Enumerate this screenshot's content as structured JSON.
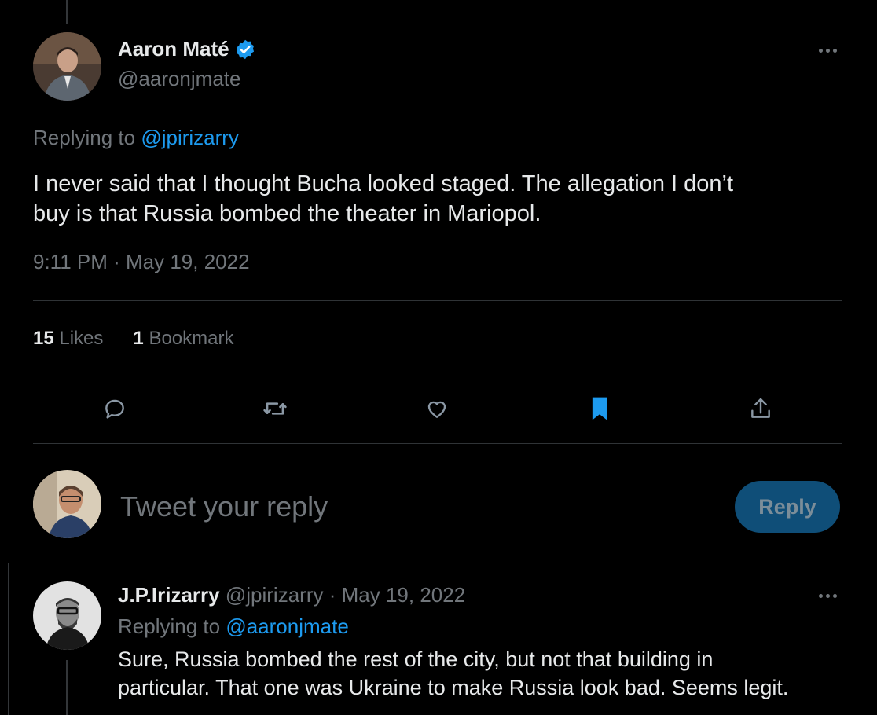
{
  "main_tweet": {
    "author_name": "Aaron Maté",
    "author_handle": "@aaronjmate",
    "replying_prefix": "Replying to",
    "replying_to": "@jpirizarry",
    "text_line1": "I never said that I thought Bucha looked staged. The allegation I don’t",
    "text_line2": "buy is that Russia bombed the theater in Mariopol.",
    "timestamp": "9:11 PM · May 19, 2022",
    "likes_count": "15",
    "likes_label": "Likes",
    "bookmarks_count": "1",
    "bookmarks_label": "Bookmark"
  },
  "actions": {
    "icons": [
      "reply-icon",
      "retweet-icon",
      "like-icon",
      "bookmark-icon",
      "share-icon"
    ],
    "bookmark_active_color": "#1d9bf0"
  },
  "composer": {
    "placeholder": "Tweet your reply",
    "button_label": "Reply"
  },
  "reply_tweet": {
    "author_name": "J.P.Irizarry",
    "author_handle": "@jpirizarry",
    "separator": "·",
    "date": "May 19, 2022",
    "replying_prefix": "Replying to",
    "replying_to": "@aaronjmate",
    "text_line1": "Sure, Russia bombed the rest of the city, but not that building in",
    "text_line2": "particular. That one was Ukraine to make Russia look bad. Seems legit."
  },
  "colors": {
    "background": "#000000",
    "text": "#e7e9ea",
    "muted": "#71767b",
    "accent": "#1d9bf0",
    "verified": "#1d9bf0"
  }
}
